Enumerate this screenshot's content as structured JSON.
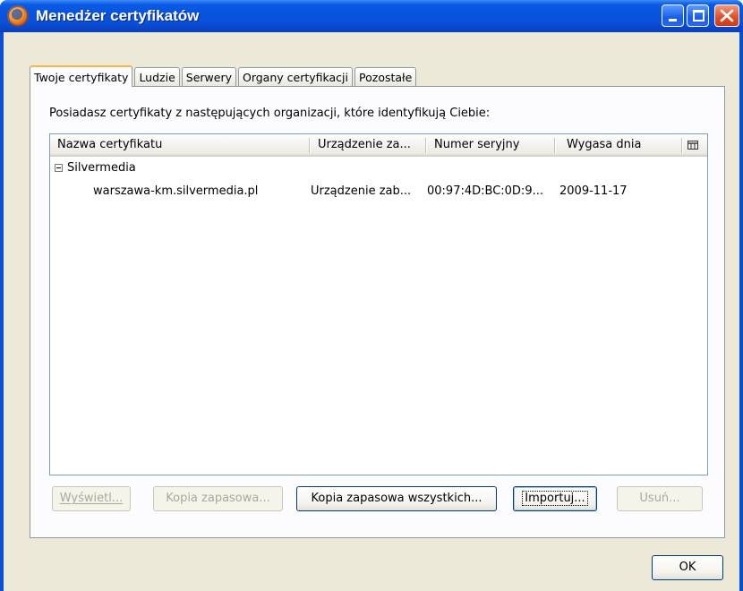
{
  "window": {
    "title": "Menedżer certyfikatów",
    "app_icon": "firefox-icon",
    "controls": [
      "minimize-icon",
      "maximize-icon",
      "close-icon"
    ]
  },
  "tabs": [
    {
      "label": "Twoje certyfikaty",
      "active": true
    },
    {
      "label": "Ludzie",
      "active": false
    },
    {
      "label": "Serwery",
      "active": false
    },
    {
      "label": "Organy certyfikacji",
      "active": false
    },
    {
      "label": "Pozostałe",
      "active": false
    }
  ],
  "panel": {
    "description": "Posiadasz certyfikaty z następujących organizacji, które identyfikują Ciebie:"
  },
  "tree": {
    "columns": [
      "Nazwa certyfikatu",
      "Urządzenie za...",
      "Numer seryjny",
      "Wygasa dnia"
    ],
    "column_picker_icon": "column-picker-icon",
    "group": {
      "expander_icon": "collapse-icon",
      "label": "Silvermedia"
    },
    "rows": [
      {
        "name": "warszawa-km.silvermedia.pl",
        "device": "Urządzenie zab...",
        "serial": "00:97:4D:BC:0D:9...",
        "expires": "2009-11-17"
      }
    ]
  },
  "buttons": {
    "view": "Wyświetl...",
    "backup": "Kopia zapasowa...",
    "backup_all": "Kopia zapasowa wszystkich...",
    "import": "Importuj...",
    "delete": "Usuń..."
  },
  "ok": "OK"
}
